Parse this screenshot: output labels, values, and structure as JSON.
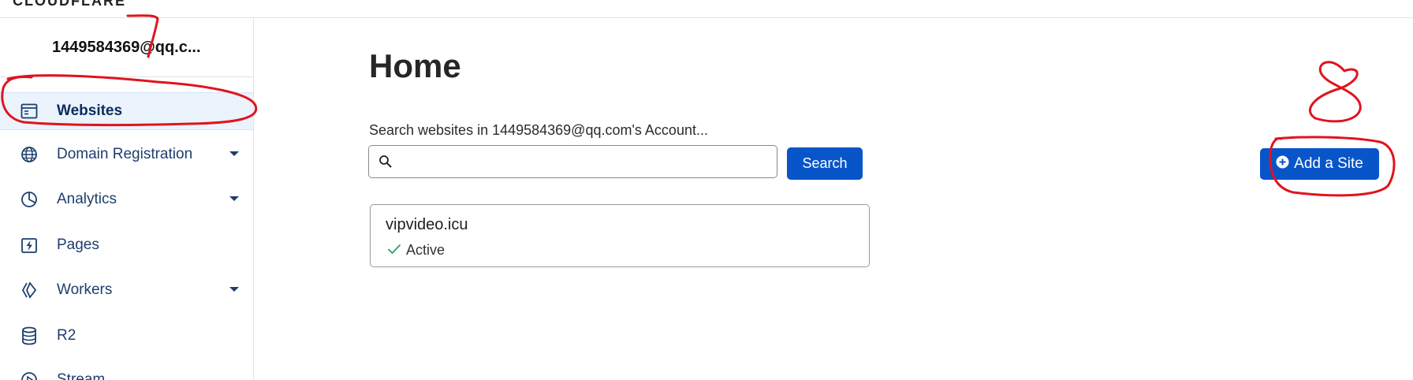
{
  "brand": {
    "text": "CLOUDFLARE"
  },
  "sidebar": {
    "account": "1449584369@qq.c...",
    "items": [
      {
        "label": "Websites",
        "icon": "browser-window-icon",
        "active": true,
        "has_caret": false
      },
      {
        "label": "Domain Registration",
        "icon": "globe-icon",
        "active": false,
        "has_caret": true
      },
      {
        "label": "Analytics",
        "icon": "pie-chart-icon",
        "active": false,
        "has_caret": true
      },
      {
        "label": "Pages",
        "icon": "lightning-page-icon",
        "active": false,
        "has_caret": false
      },
      {
        "label": "Workers",
        "icon": "workers-icon",
        "active": false,
        "has_caret": true
      },
      {
        "label": "R2",
        "icon": "database-icon",
        "active": false,
        "has_caret": false
      },
      {
        "label": "Stream",
        "icon": "play-circle-icon",
        "active": false,
        "has_caret": false
      }
    ]
  },
  "main": {
    "title": "Home",
    "search": {
      "caption": "Search websites in 1449584369@qq.com's Account...",
      "value": "",
      "placeholder": "",
      "button_label": "Search"
    },
    "add_site": {
      "label": "Add a Site"
    },
    "sites": [
      {
        "domain": "vipvideo.icu",
        "status": "Active"
      }
    ]
  },
  "annotation": {
    "number": "8"
  },
  "colors": {
    "accent": "#0755c9",
    "nav_text": "#1d3e6e",
    "active_bg": "#ebf3fd",
    "status_ok": "#2e9e5b",
    "annotation_red": "#e0141e"
  }
}
